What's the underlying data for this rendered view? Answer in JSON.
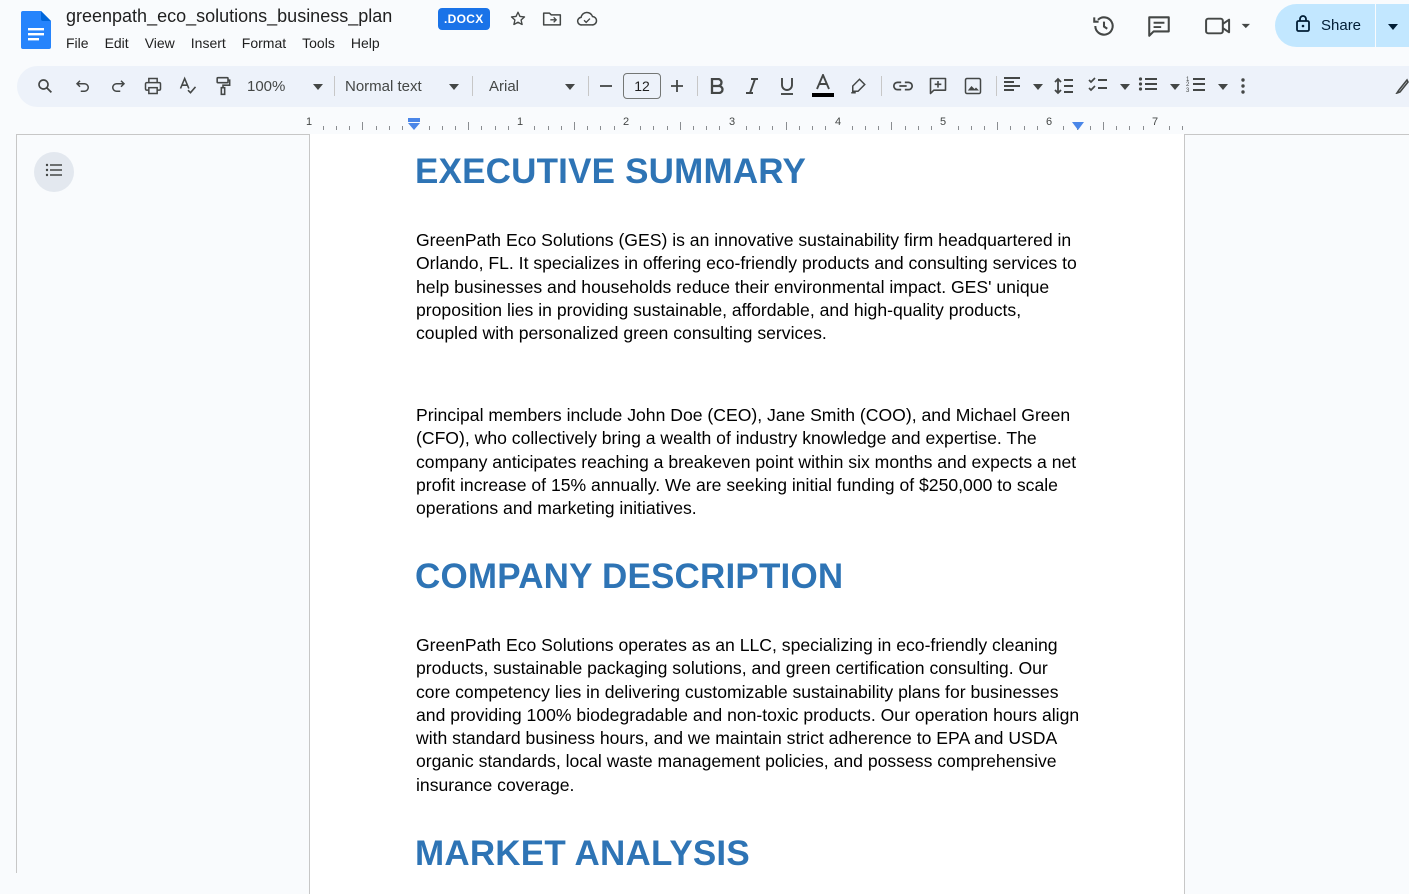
{
  "document": {
    "title": "greenpath_eco_solutions_business_plan",
    "badge": ".DOCX"
  },
  "menu": [
    "File",
    "Edit",
    "View",
    "Insert",
    "Format",
    "Tools",
    "Help"
  ],
  "header": {
    "share_label": "Share"
  },
  "toolbar": {
    "zoom": "100%",
    "style": "Normal text",
    "font": "Arial",
    "font_size": "12"
  },
  "ruler": {
    "labels": [
      "1",
      "1",
      "2",
      "3",
      "4",
      "5",
      "6",
      "7"
    ]
  },
  "content": {
    "h1": "EXECUTIVE SUMMARY",
    "p1": "GreenPath Eco Solutions (GES) is an innovative sustainability firm headquartered in Orlando, FL. It specializes in offering eco-friendly products and consulting services to help businesses and households reduce their environmental impact. GES' unique proposition lies in providing sustainable, affordable, and high-quality products, coupled with personalized green consulting services.",
    "p2": "Principal members include John Doe (CEO), Jane Smith (COO), and Michael Green (CFO), who collectively bring a wealth of industry knowledge and expertise. The company anticipates reaching a breakeven point within six months and expects a net profit increase of 15% annually. We are seeking initial funding of $250,000 to scale operations and marketing initiatives.",
    "h2": "COMPANY DESCRIPTION",
    "p3": "GreenPath Eco Solutions operates as an LLC, specializing in eco-friendly cleaning products, sustainable packaging solutions, and green certification consulting. Our core competency lies in delivering customizable sustainability plans for businesses and providing 100% biodegradable and non-toxic products. Our operation hours align with standard business hours, and we maintain strict adherence to EPA and USDA organic standards, local waste management policies, and possess comprehensive insurance coverage.",
    "h3": "MARKET ANALYSIS"
  },
  "colors": {
    "heading": "#2e74b5",
    "share_bg": "#c2e7ff",
    "toolbar_bg": "#edf2fa",
    "badge_bg": "#1a73e8"
  }
}
